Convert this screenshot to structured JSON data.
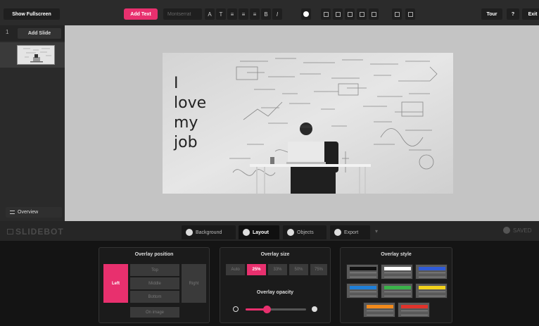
{
  "toolbar": {
    "fullscreen_label": "Show Fullscreen",
    "add_text_label": "Add Text",
    "font_family": "Montserrat",
    "tour_label": "Tour",
    "help_label": "?",
    "exit_label": "Exit",
    "tools": [
      "font-size-icon",
      "text-height-icon",
      "align-left-icon",
      "align-center-icon",
      "align-right-icon",
      "bold-icon",
      "italic-icon",
      "color-icon",
      "grid-icon",
      "layers-icon",
      "text-background-icon",
      "duplicate-icon",
      "delete-icon",
      "settings-icon",
      "comment-icon"
    ]
  },
  "sidebar": {
    "slide_number": "1",
    "add_slide_label": "Add Slide",
    "overview_label": "Overview"
  },
  "slide": {
    "lines": [
      "I",
      "love",
      "my",
      "job"
    ]
  },
  "bottom": {
    "logo": "SLIDEBOT",
    "tabs": [
      {
        "label": "Background",
        "active": false
      },
      {
        "label": "Layout",
        "active": true
      },
      {
        "label": "Objects",
        "active": false
      },
      {
        "label": "Export",
        "active": false
      }
    ],
    "more_label": "▾",
    "saved_label": "SAVED"
  },
  "panel": {
    "position": {
      "title": "Overlay position",
      "left": "Left",
      "top": "Top",
      "middle": "Middle",
      "bottom": "Bottom",
      "right": "Right",
      "on_image": "On image",
      "selected": "Left"
    },
    "size": {
      "title": "Overlay size",
      "options": [
        "Auto",
        "25%",
        "33%",
        "50%",
        "75%"
      ],
      "selected": "25%",
      "opacity_title": "Overlay opacity",
      "opacity_value": 0.35
    },
    "style": {
      "title": "Overlay style",
      "swatches": [
        "#111111",
        "#ffffff",
        "#2f5bd8",
        "#1f7fd8",
        "#3bb34a",
        "#f2d21b",
        "#f28a1b",
        "#e0332b"
      ]
    },
    "accent_color": "#e8306e"
  }
}
